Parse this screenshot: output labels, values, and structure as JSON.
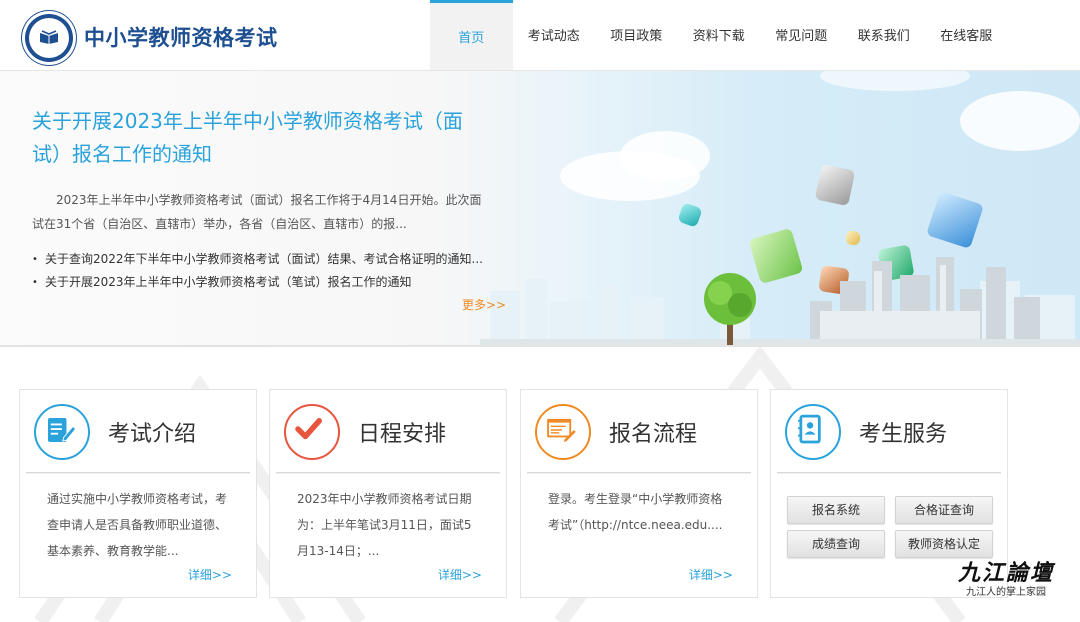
{
  "header": {
    "site_title": "中小学教师资格考试",
    "nav": [
      {
        "label": "首页",
        "active": true
      },
      {
        "label": "考试动态"
      },
      {
        "label": "项目政策"
      },
      {
        "label": "资料下载"
      },
      {
        "label": "常见问题"
      },
      {
        "label": "联系我们"
      },
      {
        "label": "在线客服"
      }
    ]
  },
  "banner": {
    "headline": "关于开展2023年上半年中小学教师资格考试（面试）报名工作的通知",
    "summary": "2023年上半年中小学教师资格考试（面试）报名工作将于4月14日开始。此次面试在31个省（自治区、直辖市）举办，各省（自治区、直辖市）的报...",
    "news": [
      "关于查询2022年下半年中小学教师资格考试（面试）结果、考试合格证明的通知...",
      "关于开展2023年上半年中小学教师资格考试（笔试）报名工作的通知"
    ],
    "more_label": "更多>>"
  },
  "cards": [
    {
      "title": "考试介绍",
      "icon": "document-edit-icon",
      "text": "通过实施中小学教师资格考试，考查申请人是否具备教师职业道德、基本素养、教育教学能...",
      "more": "详细>>",
      "color": "#2aa2dc"
    },
    {
      "title": "日程安排",
      "icon": "checkmark-icon",
      "text": "2023年中小学教师资格考试日期为：上半年笔试3月11日，面试5月13-14日；...",
      "more": "详细>>",
      "color": "#e8553d"
    },
    {
      "title": "报名流程",
      "icon": "form-icon",
      "text": "登录。考生登录“中小学教师资格考试”（http://ntce.neea.edu....",
      "more": "详细>>",
      "color": "#f08a24"
    },
    {
      "title": "考生服务",
      "icon": "contact-book-icon",
      "color": "#2aa2dc",
      "buttons": [
        "报名系统",
        "合格证查询",
        "成绩查询",
        "教师资格认定"
      ]
    }
  ],
  "watermark": {
    "script": "九江論壇",
    "subtitle": "九江人的掌上家园"
  }
}
